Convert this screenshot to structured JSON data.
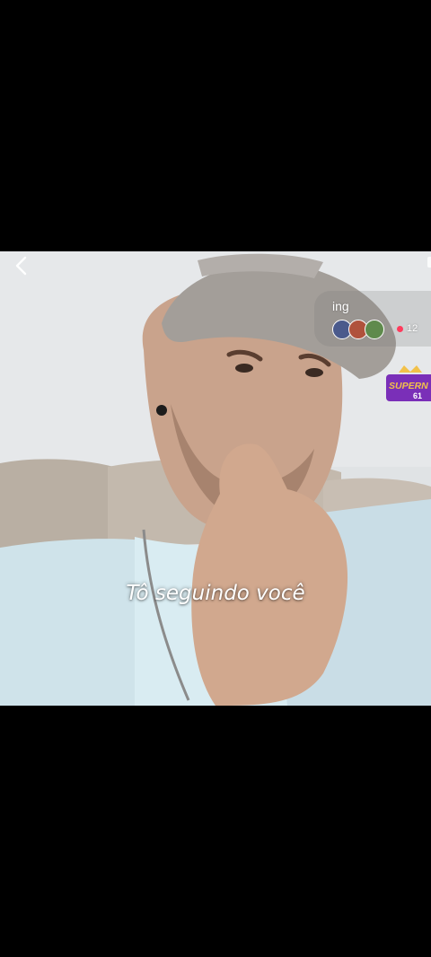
{
  "header": {
    "back_icon": "chevron-left-icon"
  },
  "live_card": {
    "title": "ing",
    "viewer_count": "12",
    "viewer_icon": "red-dot-icon",
    "avatar_colors": [
      "#4a5a8c",
      "#b0523c",
      "#5f8a4c"
    ]
  },
  "event_badge": {
    "text": "SUPERN",
    "subtext": "61",
    "icon": "crown-icon"
  },
  "caption": {
    "text": "Tô seguindo você"
  },
  "colors": {
    "background": "#000000",
    "badge_purple": "#7a2fb8",
    "badge_gold": "#f2c14a",
    "viewer_dot": "#ff3b5c"
  }
}
